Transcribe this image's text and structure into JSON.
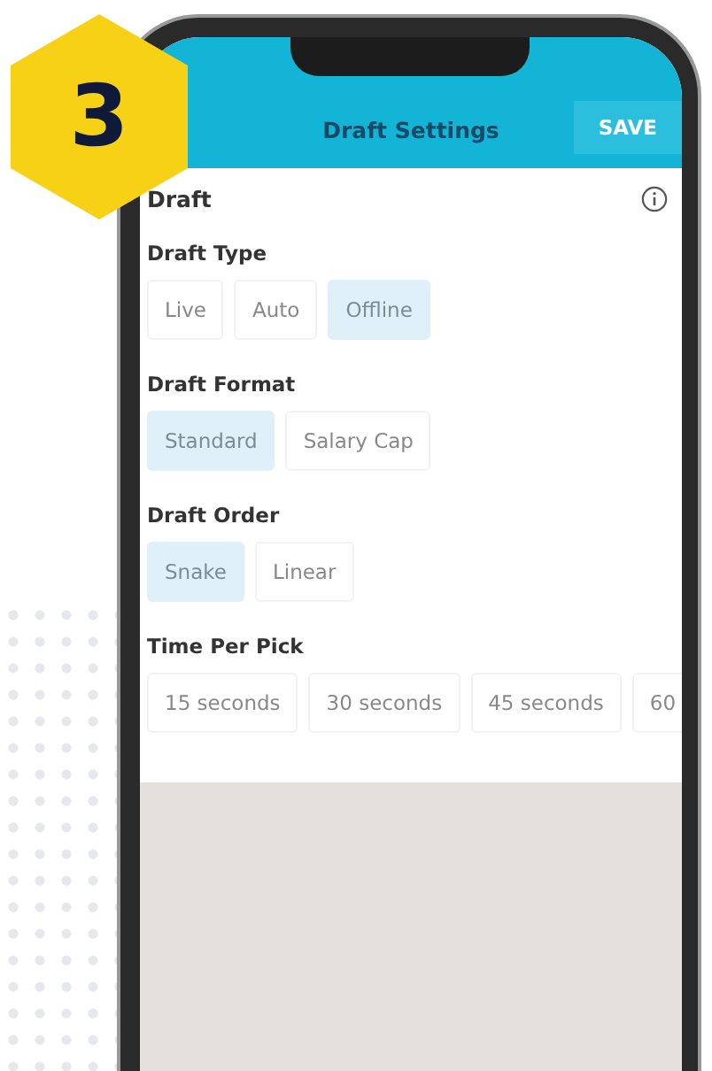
{
  "badge": {
    "label": "3"
  },
  "header": {
    "title": "Draft Settings",
    "save": "SAVE"
  },
  "section": {
    "title": "Draft"
  },
  "groups": [
    {
      "label": "Draft Type",
      "options": [
        {
          "label": "Live",
          "selected": false
        },
        {
          "label": "Auto",
          "selected": false
        },
        {
          "label": "Offline",
          "selected": true
        }
      ]
    },
    {
      "label": "Draft Format",
      "options": [
        {
          "label": "Standard",
          "selected": true
        },
        {
          "label": "Salary Cap",
          "selected": false
        }
      ]
    },
    {
      "label": "Draft Order",
      "options": [
        {
          "label": "Snake",
          "selected": true
        },
        {
          "label": "Linear",
          "selected": false
        }
      ]
    },
    {
      "label": "Time Per Pick",
      "options": [
        {
          "label": "15 seconds",
          "selected": false
        },
        {
          "label": "30 seconds",
          "selected": false
        },
        {
          "label": "45 seconds",
          "selected": false
        },
        {
          "label": "60",
          "selected": false
        }
      ]
    }
  ]
}
